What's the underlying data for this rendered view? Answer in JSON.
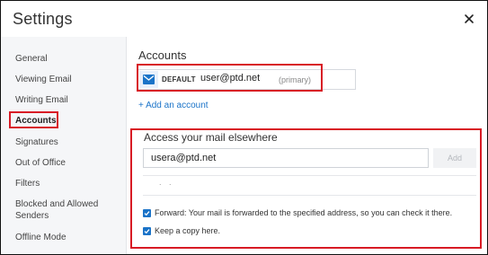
{
  "window": {
    "title": "Settings"
  },
  "sidebar": {
    "items": [
      {
        "label": "General"
      },
      {
        "label": "Viewing Email"
      },
      {
        "label": "Writing Email"
      },
      {
        "label": "Accounts",
        "active": true
      },
      {
        "label": "Signatures"
      },
      {
        "label": "Out of Office"
      },
      {
        "label": "Filters"
      },
      {
        "label": "Blocked and Allowed Senders"
      },
      {
        "label": "Offline Mode"
      }
    ]
  },
  "accounts": {
    "title": "Accounts",
    "default_badge": "DEFAULT",
    "email": "user@ptd.net",
    "primary_label": "(primary)",
    "add_account_label": "+ Add an account",
    "icon": "envelope-icon"
  },
  "access": {
    "title": "Access your mail elsewhere",
    "email_value": "usera@ptd.net",
    "add_button": "Add",
    "dots": ". .",
    "forward_label": "Forward: Your mail is forwarded to the specified address, so you can check it there.",
    "forward_checked": true,
    "copy_label": "Keep a copy here.",
    "copy_checked": true
  },
  "colors": {
    "accent": "#1a73c8",
    "highlight": "#d81b25",
    "sidebar_bg": "#f5f6f8"
  }
}
